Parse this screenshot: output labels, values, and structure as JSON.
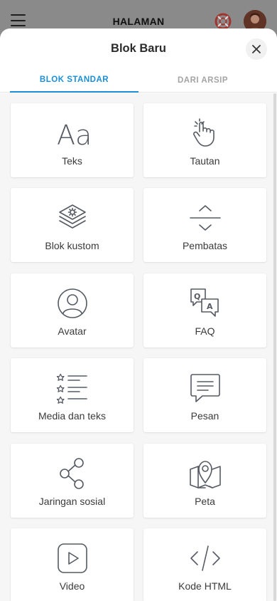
{
  "app": {
    "title": "HALAMAN"
  },
  "sheet": {
    "title": "Blok Baru",
    "close_label": "×"
  },
  "tabs": [
    {
      "label": "BLOK STANDAR",
      "active": true
    },
    {
      "label": "DARI ARSIP",
      "active": false
    }
  ],
  "blocks": [
    {
      "label": "Teks",
      "icon": "text-icon"
    },
    {
      "label": "Tautan",
      "icon": "tap-icon"
    },
    {
      "label": "Blok kustom",
      "icon": "layers-icon"
    },
    {
      "label": "Pembatas",
      "icon": "divider-icon"
    },
    {
      "label": "Avatar",
      "icon": "avatar-icon"
    },
    {
      "label": "FAQ",
      "icon": "faq-icon"
    },
    {
      "label": "Media dan teks",
      "icon": "media-list-icon"
    },
    {
      "label": "Pesan",
      "icon": "message-icon"
    },
    {
      "label": "Jaringan sosial",
      "icon": "share-icon"
    },
    {
      "label": "Peta",
      "icon": "map-icon"
    },
    {
      "label": "Video",
      "icon": "video-icon"
    },
    {
      "label": "Kode HTML",
      "icon": "code-icon"
    }
  ],
  "icon_glyphs": {
    "text": "Aa",
    "faq_q": "Q",
    "faq_a": "A"
  },
  "colors": {
    "accent": "#1a8fd8",
    "icon": "#555a63",
    "background": "#f6f6f6"
  }
}
